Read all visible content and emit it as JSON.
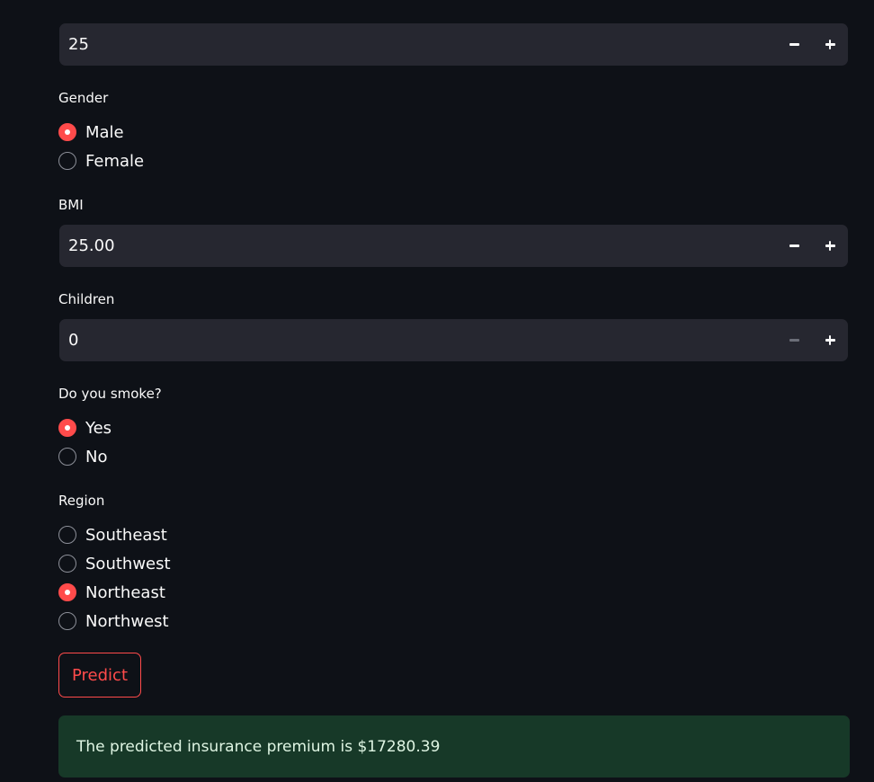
{
  "age": {
    "value": "25"
  },
  "gender": {
    "label": "Gender",
    "options": [
      "Male",
      "Female"
    ],
    "selected": "Male"
  },
  "bmi": {
    "label": "BMI",
    "value": "25.00"
  },
  "children": {
    "label": "Children",
    "value": "0"
  },
  "smoke": {
    "label": "Do you smoke?",
    "options": [
      "Yes",
      "No"
    ],
    "selected": "Yes"
  },
  "region": {
    "label": "Region",
    "options": [
      "Southeast",
      "Southwest",
      "Northeast",
      "Northwest"
    ],
    "selected": "Northeast"
  },
  "predict_button": {
    "label": "Predict"
  },
  "result": {
    "text": "The predicted insurance premium is $17280.39"
  },
  "colors": {
    "background": "#0e1117",
    "input_bg": "#262730",
    "accent": "#ff4b4b",
    "success_bg": "#173928"
  }
}
